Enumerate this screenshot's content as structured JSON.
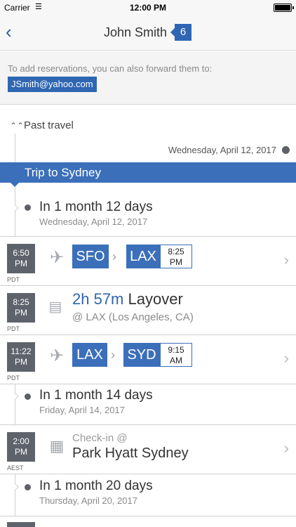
{
  "status_bar": {
    "carrier": "Carrier",
    "time": "12:00 PM"
  },
  "nav": {
    "title": "John Smith",
    "badge": "6"
  },
  "forward": {
    "hint": "To add reservations, you can also forward them to:",
    "email": "JSmith@yahoo.com"
  },
  "past_travel": "Past travel",
  "timeline_start_date": "Wednesday, April 12, 2017",
  "trip_title": "Trip to Sydney",
  "milestones": [
    {
      "title": "In 1 month 12 days",
      "date": "Wednesday, April 12, 2017"
    },
    {
      "title": "In 1 month 14 days",
      "date": "Friday, April 14, 2017"
    },
    {
      "title": "In 1 month 20 days",
      "date": "Thursday, April 20, 2017"
    }
  ],
  "flights": [
    {
      "dep_time": "6:50",
      "dep_ampm": "PM",
      "tz": "PDT",
      "from": "SFO",
      "to": "LAX",
      "arr_time": "8:25",
      "arr_ampm": "PM"
    },
    {
      "dep_time": "11:22",
      "dep_ampm": "PM",
      "tz": "PDT",
      "from": "LAX",
      "to": "SYD",
      "arr_time": "9:15",
      "arr_ampm": "AM"
    }
  ],
  "layover": {
    "time": "8:25",
    "ampm": "PM",
    "tz": "PDT",
    "duration": "2h 57m",
    "label": "Layover",
    "location": "@ LAX (Los Angeles, CA)"
  },
  "hotel": {
    "time": "2:00",
    "ampm": "PM",
    "tz": "AEST",
    "label": "Check-in @",
    "name": "Park Hyatt Sydney"
  },
  "colors": {
    "accent": "#3b6fba",
    "time_box": "#5e636b"
  }
}
